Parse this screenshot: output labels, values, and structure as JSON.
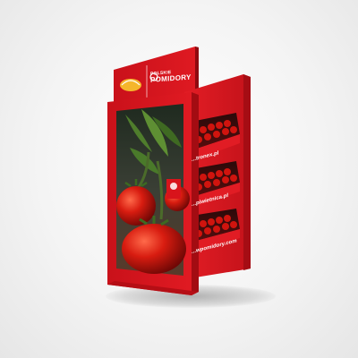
{
  "image": {
    "subject": "red-point-of-sale-display-stand-with-tomato-panel",
    "colors": {
      "stand_red": "#d8141b",
      "stand_dark_red": "#9e0c10",
      "tomato": "#c8180f",
      "leaf": "#4f7d2c",
      "background": "#f2f2f2"
    }
  },
  "header": {
    "brand_left": "",
    "brand_right_line1": "POLSKIE",
    "brand_right_line2": "POMIDORY"
  },
  "shelves": {
    "url_1": "...tronex.pl",
    "url_2": "...piwietnica.pl",
    "url_3": "...wpomidory.com"
  }
}
